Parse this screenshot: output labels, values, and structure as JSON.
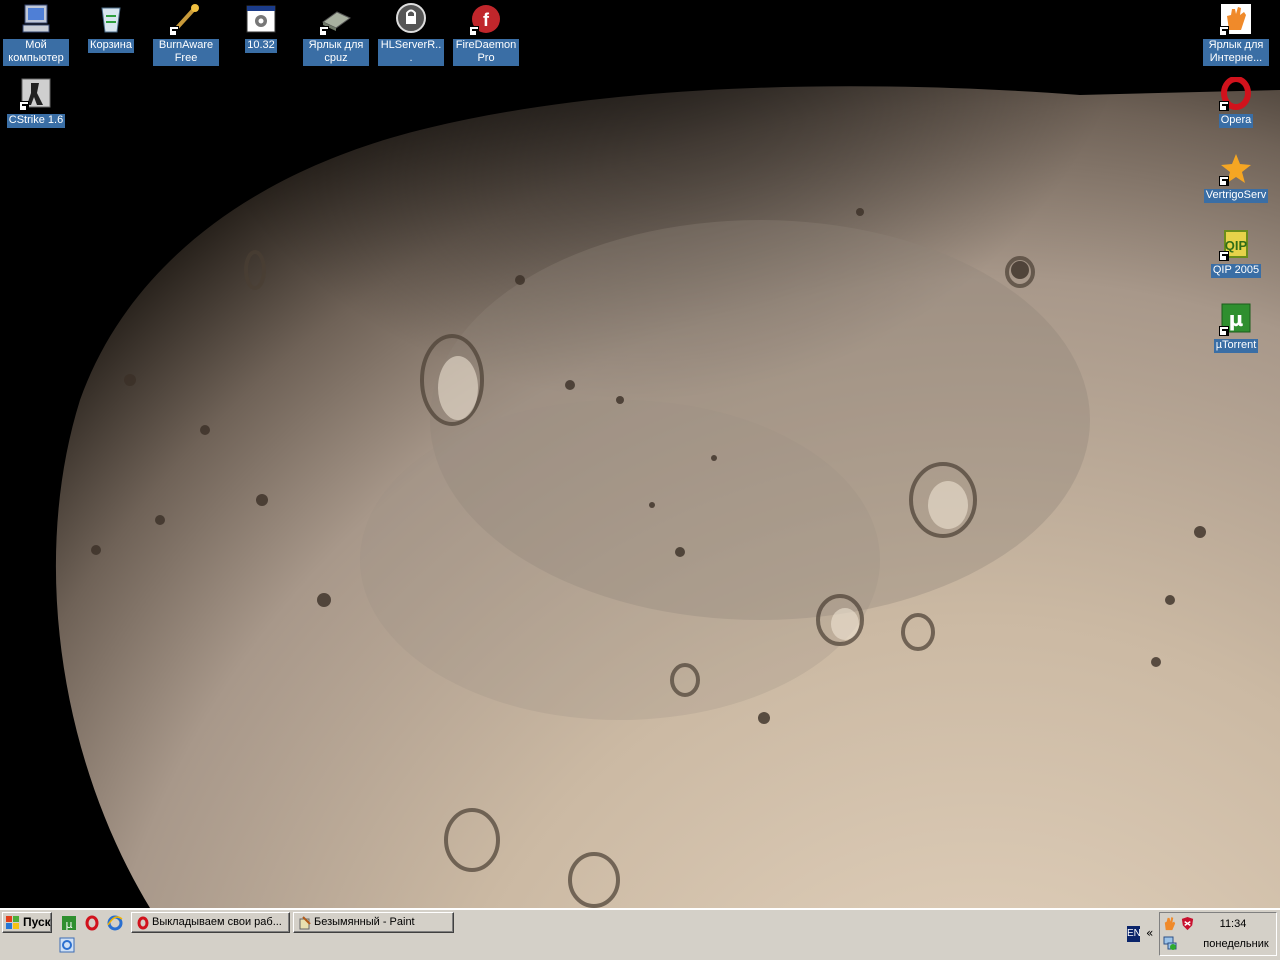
{
  "desktop": {
    "left_icons": [
      {
        "label": "Мой компьютер",
        "icon": "my-computer-icon"
      },
      {
        "label": "Корзина",
        "icon": "recycle-bin-icon"
      },
      {
        "label": "BurnAware Free",
        "icon": "burnaware-icon"
      },
      {
        "label": "10.32",
        "icon": "app-window-icon"
      },
      {
        "label": "Ярлык для cpuz",
        "icon": "cpuz-icon"
      },
      {
        "label": "HLServerR...",
        "icon": "hlserver-icon"
      },
      {
        "label": "FireDaemon Pro",
        "icon": "firedaemon-icon"
      },
      {
        "label": "CStrike 1.6",
        "icon": "cstrike-icon"
      }
    ],
    "right_icons": [
      {
        "label": "Ярлык для Интерне...",
        "icon": "hand-icon"
      },
      {
        "label": "Opera",
        "icon": "opera-icon"
      },
      {
        "label": "VertrigoServ",
        "icon": "vertrigo-icon"
      },
      {
        "label": "QIP 2005",
        "icon": "qip-icon"
      },
      {
        "label": "µTorrent",
        "icon": "utorrent-icon"
      }
    ]
  },
  "taskbar": {
    "start_label": "Пуск",
    "quick_launch": [
      "utorrent-icon",
      "opera-icon",
      "ie-icon",
      "ie-small-icon"
    ],
    "tasks": [
      {
        "label": "Выкладываем свои раб...",
        "icon": "opera-icon"
      },
      {
        "label": "Безымянный - Paint",
        "icon": "paint-icon"
      }
    ],
    "language": "EN",
    "tray_arrow": "«",
    "clock": {
      "time": "11:34",
      "day": "понедельник"
    }
  },
  "colors": {
    "desktop_label_bg": "#3a6ea5",
    "taskbar_bg": "#d4d0c8"
  }
}
